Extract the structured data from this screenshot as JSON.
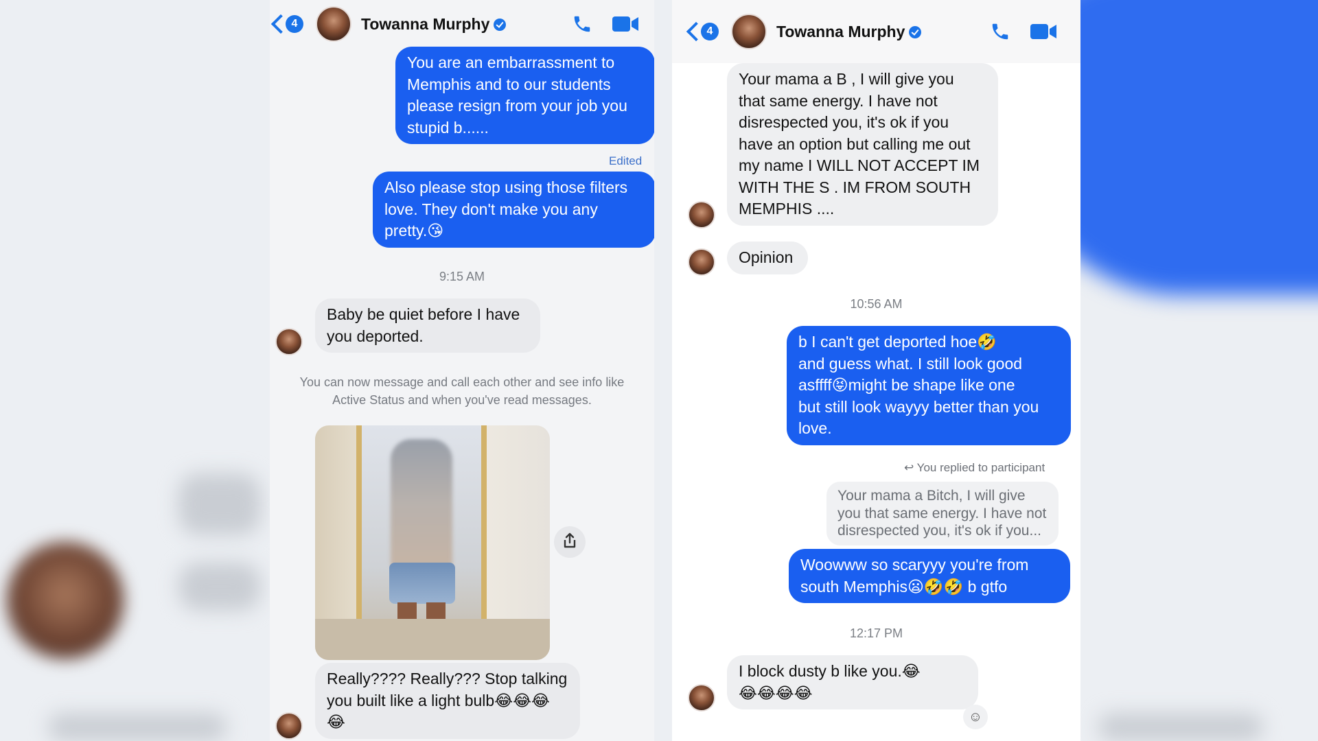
{
  "left_panel": {
    "header": {
      "back_badge": "4",
      "contact_name": "Towanna Murphy",
      "icons": [
        "back-chevron-icon",
        "verified-badge-icon",
        "phone-icon",
        "video-call-icon"
      ]
    },
    "messages": {
      "out_1": "You are an embarrassment to\nMemphis and to our students\nplease resign from your job you\nstupid b......",
      "edited_label": "Edited",
      "out_2": "Also please stop using those filters\nlove. They don't make you any\npretty.😘",
      "time_1": "9:15 AM",
      "in_1": "Baby be quiet before I have\nyou deported.",
      "system_note": "You can now message and call each other and see info like\nActive Status and when you've read messages.",
      "in_2": "Really???? Really??? Stop talking\nyou built like a light bulb😂😂😂\n😂"
    }
  },
  "right_panel": {
    "header": {
      "back_badge": "4",
      "contact_name": "Towanna Murphy"
    },
    "messages": {
      "in_1": "Your mama a B     , I will give you\nthat same energy. I have not\ndisrespected you, it's ok if you\nhave an option but calling me out\nmy name I WILL NOT ACCEPT IM\nWITH THE S     . IM FROM SOUTH\nMEMPHIS ....",
      "in_2": "Opinion",
      "time_1": "10:56 AM",
      "out_1": "b      I can't get deported hoe🤣\nand guess what. I still look good\nasffff😝might be shape like one\nbut still look wayyy better than you\nlove.",
      "replied_note": "You replied to participant",
      "quoted": "Your mama a Bitch, I will give\nyou that same energy. I have not\ndisrespected you, it's ok if you...",
      "out_2": "Woowww so scaryyy you're from\nsouth Memphis😦🤣🤣 b      gtfo",
      "time_2": "12:17 PM",
      "in_3": "I block dusty b          like you.😂\n😂😂😂😂"
    }
  },
  "colors": {
    "outgoing_bubble": "#1a5ff0",
    "incoming_bubble": "#e9eaed",
    "accent": "#1a73e8",
    "background_blur_blue": "#2f6cf0"
  }
}
